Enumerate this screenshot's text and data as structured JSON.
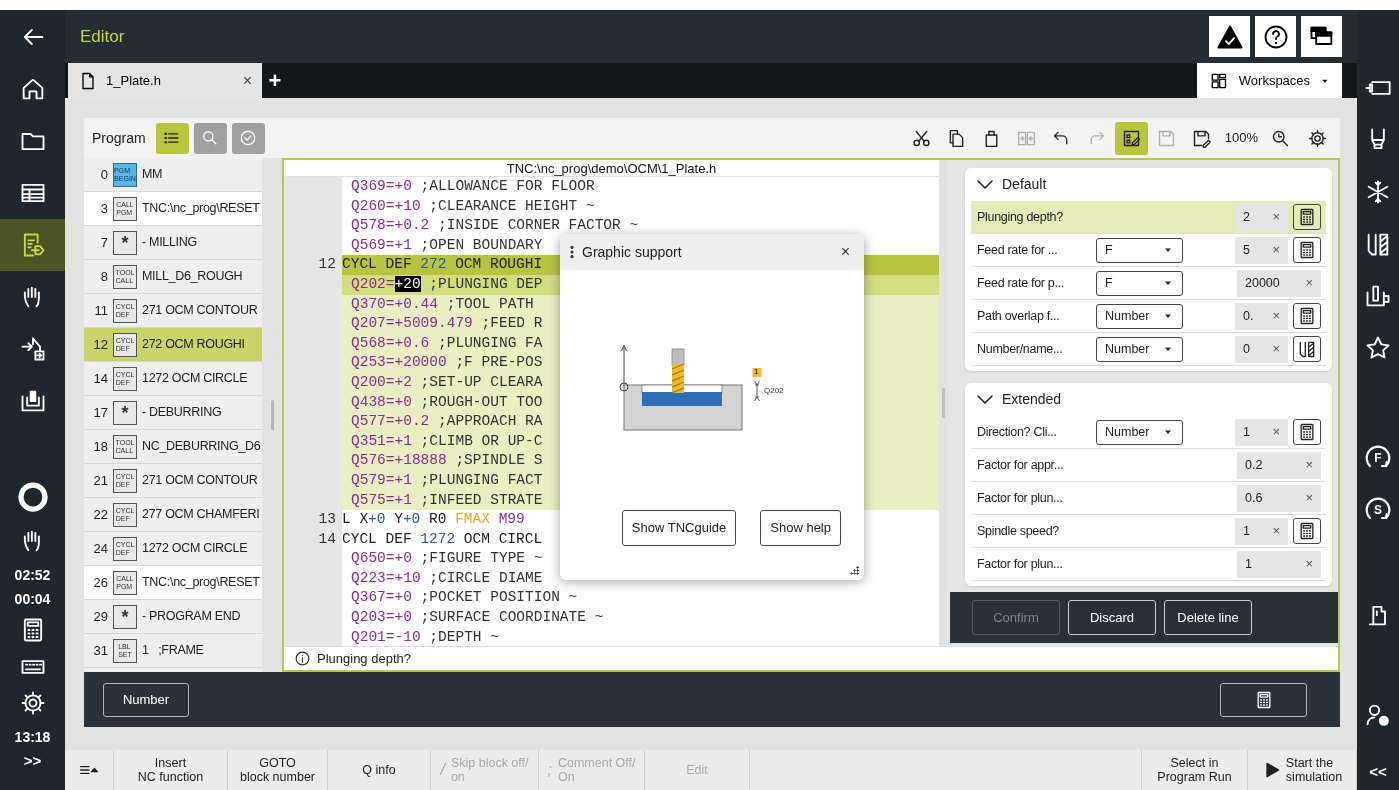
{
  "header": {
    "title": "Editor"
  },
  "left_nav": {
    "items": [
      {
        "selected": false
      },
      {
        "selected": false
      },
      {
        "selected": false
      },
      {
        "selected": true
      },
      {
        "selected": false
      },
      {
        "selected": false
      },
      {
        "selected": false
      }
    ],
    "timers": [
      "02:52",
      "00:04"
    ],
    "clock": "13:18",
    "expand": ">>"
  },
  "right_nav": {
    "override_buttons": [
      "F",
      "S"
    ],
    "collapse": "<<"
  },
  "tabs": [
    {
      "label": "1_Plate.h",
      "close": "×",
      "selected": true
    }
  ],
  "new_tab": "+",
  "workspaces": {
    "label": "Workspaces"
  },
  "toolbar": {
    "title": "Program",
    "views": [
      {
        "selected": true
      },
      {
        "selected": false
      },
      {
        "selected": false
      }
    ],
    "tools": [
      {
        "disabled": false,
        "selected": false
      },
      {
        "disabled": false,
        "selected": false
      },
      {
        "disabled": false,
        "selected": false
      },
      {
        "disabled": true,
        "selected": false
      },
      {
        "disabled": false,
        "selected": false
      },
      {
        "disabled": true,
        "selected": false
      },
      {
        "disabled": false,
        "selected": true
      },
      {
        "disabled": true,
        "selected": false
      },
      {
        "disabled": false,
        "selected": false
      }
    ],
    "zoom_level": "100%"
  },
  "program": {
    "rows": [
      {
        "number": "0",
        "badge": [
          "PGM",
          "BEGIN"
        ],
        "kind": "begin",
        "text": "MM",
        "selected": false
      },
      {
        "number": "3",
        "badge": [
          "CALL",
          "PGM"
        ],
        "kind": "call",
        "text": "TNC:\\nc_prog\\RESET",
        "selected": false
      },
      {
        "number": "7",
        "badge": [
          "*"
        ],
        "kind": "comment",
        "text": "- MILLING",
        "selected": false
      },
      {
        "number": "8",
        "badge": [
          "TOOL",
          "CALL"
        ],
        "kind": "tool",
        "text": "MILL_D6_ROUGH",
        "selected": false
      },
      {
        "number": "11",
        "badge": [
          "CYCL",
          "DEF"
        ],
        "kind": "cycle",
        "text": "271 OCM CONTOUR",
        "selected": false
      },
      {
        "number": "12",
        "badge": [
          "CYCL",
          "DEF"
        ],
        "kind": "cycle",
        "text": "272 OCM ROUGHI",
        "selected": true
      },
      {
        "number": "14",
        "badge": [
          "CYCL",
          "DEF"
        ],
        "kind": "cycle",
        "text": "1272 OCM CIRCLE",
        "selected": false
      },
      {
        "number": "17",
        "badge": [
          "*"
        ],
        "kind": "comment",
        "text": "- DEBURRING",
        "selected": false
      },
      {
        "number": "18",
        "badge": [
          "TOOL",
          "CALL"
        ],
        "kind": "tool",
        "text": "NC_DEBURRING_D6",
        "selected": false
      },
      {
        "number": "21",
        "badge": [
          "CYCL",
          "DEF"
        ],
        "kind": "cycle",
        "text": "271 OCM CONTOUR",
        "selected": false
      },
      {
        "number": "22",
        "badge": [
          "CYCL",
          "DEF"
        ],
        "kind": "cycle",
        "text": "277 OCM CHAMFERI",
        "selected": false
      },
      {
        "number": "24",
        "badge": [
          "CYCL",
          "DEF"
        ],
        "kind": "cycle",
        "text": "1272 OCM CIRCLE",
        "selected": false
      },
      {
        "number": "26",
        "badge": [
          "CALL",
          "PGM"
        ],
        "kind": "call",
        "text": "TNC:\\nc_prog\\RESET",
        "selected": false
      },
      {
        "number": "29",
        "badge": [
          "*"
        ],
        "kind": "comment",
        "text": "- PROGRAM END",
        "selected": false
      },
      {
        "number": "31",
        "badge": [
          "LBL",
          "SET"
        ],
        "kind": "label",
        "text": "1   ;FRAME",
        "selected": false
      }
    ]
  },
  "code": {
    "path": "TNC:\\nc_prog\\demo\\OCM\\1_Plate.h",
    "lines": [
      {
        "kind": "plain",
        "parts": [
          {
            "text": "Q369=+0",
            "kind": "param"
          },
          {
            "text": " ;ALLOWANCE FOR FLOOR",
            "kind": "comment"
          }
        ]
      },
      {
        "kind": "plain",
        "parts": [
          {
            "text": "Q260=+10",
            "kind": "param"
          },
          {
            "text": " ;CLEARANCE HEIGHT ~",
            "kind": "comment"
          }
        ]
      },
      {
        "kind": "plain",
        "parts": [
          {
            "text": "Q578=+0.2",
            "kind": "param"
          },
          {
            "text": " ;INSIDE CORNER FACTOR ~",
            "kind": "comment"
          }
        ]
      },
      {
        "kind": "plain",
        "parts": [
          {
            "text": "Q569=+1",
            "kind": "param"
          },
          {
            "text": " ;OPEN BOUNDARY",
            "kind": "comment"
          }
        ]
      },
      {
        "number": "12",
        "kind": "head",
        "parts": [
          {
            "text": "CYCL DEF ",
            "kind": "keyword"
          },
          {
            "text": "272",
            "kind": "number"
          },
          {
            "text": " OCM ROUGHI",
            "kind": "keyword"
          }
        ]
      },
      {
        "kind": "current",
        "parts": [
          {
            "text": "Q202=",
            "kind": "param"
          },
          {
            "text": "+20",
            "kind": "cursor"
          },
          {
            "text": " ;PLUNGING DEP",
            "kind": "comment"
          }
        ]
      },
      {
        "kind": "block",
        "parts": [
          {
            "text": "Q370=+0.44",
            "kind": "param"
          },
          {
            "text": " ;TOOL PATH",
            "kind": "comment"
          }
        ]
      },
      {
        "kind": "block",
        "parts": [
          {
            "text": "Q207=+5009.479",
            "kind": "param"
          },
          {
            "text": " ;FEED R",
            "kind": "comment"
          }
        ]
      },
      {
        "kind": "block",
        "parts": [
          {
            "text": "Q568=+0.6",
            "kind": "param"
          },
          {
            "text": " ;PLUNGING FA",
            "kind": "comment"
          }
        ]
      },
      {
        "kind": "block",
        "parts": [
          {
            "text": "Q253=+20000",
            "kind": "param"
          },
          {
            "text": " ;F PRE-POS",
            "kind": "comment"
          }
        ]
      },
      {
        "kind": "block",
        "parts": [
          {
            "text": "Q200=+2",
            "kind": "param"
          },
          {
            "text": " ;SET-UP CLEARA",
            "kind": "comment"
          }
        ]
      },
      {
        "kind": "block",
        "parts": [
          {
            "text": "Q438=+0",
            "kind": "param"
          },
          {
            "text": " ;ROUGH-OUT TOO",
            "kind": "comment"
          }
        ]
      },
      {
        "kind": "block",
        "parts": [
          {
            "text": "Q577=+0.2",
            "kind": "param"
          },
          {
            "text": " ;APPROACH RA",
            "kind": "comment"
          }
        ]
      },
      {
        "kind": "block",
        "parts": [
          {
            "text": "Q351=+1",
            "kind": "param"
          },
          {
            "text": " ;CLIMB OR UP-C",
            "kind": "comment"
          }
        ]
      },
      {
        "kind": "block",
        "parts": [
          {
            "text": "Q576=+18888",
            "kind": "param"
          },
          {
            "text": " ;SPINDLE S",
            "kind": "comment"
          }
        ]
      },
      {
        "kind": "block",
        "parts": [
          {
            "text": "Q579=+1",
            "kind": "param"
          },
          {
            "text": " ;PLUNGING FACT",
            "kind": "comment"
          }
        ]
      },
      {
        "kind": "block",
        "parts": [
          {
            "text": "Q575=+1",
            "kind": "param"
          },
          {
            "text": " ;INFEED STRATE",
            "kind": "comment"
          }
        ]
      },
      {
        "number": "13",
        "kind": "plain",
        "parts": [
          {
            "text": "L X",
            "kind": "keyword"
          },
          {
            "text": "+0",
            "kind": "number"
          },
          {
            "text": " Y",
            "kind": "keyword"
          },
          {
            "text": "+0",
            "kind": "number"
          },
          {
            "text": " R0 ",
            "kind": "keyword"
          },
          {
            "text": "FMAX",
            "kind": "rapid"
          },
          {
            "text": " M99",
            "kind": "param"
          }
        ]
      },
      {
        "number": "14",
        "kind": "plain",
        "parts": [
          {
            "text": "CYCL DEF ",
            "kind": "keyword"
          },
          {
            "text": "1272",
            "kind": "number"
          },
          {
            "text": " OCM CIRCL",
            "kind": "keyword"
          }
        ]
      },
      {
        "kind": "plain",
        "parts": [
          {
            "text": "Q650=+0",
            "kind": "param"
          },
          {
            "text": " ;FIGURE TYPE ~",
            "kind": "comment"
          }
        ]
      },
      {
        "kind": "plain",
        "parts": [
          {
            "text": "Q223=+10",
            "kind": "param"
          },
          {
            "text": " ;CIRCLE DIAME",
            "kind": "comment"
          }
        ]
      },
      {
        "kind": "plain",
        "parts": [
          {
            "text": "Q367=+0",
            "kind": "param"
          },
          {
            "text": " ;POCKET POSITION ~",
            "kind": "comment"
          }
        ]
      },
      {
        "kind": "plain",
        "parts": [
          {
            "text": "Q203=+0",
            "kind": "param"
          },
          {
            "text": " ;SURFACE COORDINATE ~",
            "kind": "comment"
          }
        ]
      },
      {
        "kind": "plain",
        "parts": [
          {
            "text": "Q201=-10",
            "kind": "param"
          },
          {
            "text": " ;DEPTH ~",
            "kind": "comment"
          }
        ]
      }
    ]
  },
  "popup": {
    "title": "Graphic support",
    "close": "×",
    "figure_labels": [
      "1",
      "Q202"
    ],
    "buttons": [
      "Show TNCguide",
      "Show help"
    ]
  },
  "form": {
    "groups": [
      {
        "title": "Default",
        "expanded": true,
        "rows": [
          {
            "label": "Plunging depth?",
            "value": "2",
            "clear": "×",
            "kind": "calc",
            "selected": true
          },
          {
            "label": "Feed rate for ...",
            "select": "F",
            "value": "5",
            "clear": "×",
            "kind": "calc",
            "selected": false
          },
          {
            "label": "Feed rate for p...",
            "select": "F",
            "value": "20000",
            "clear": "×",
            "kind": "plain",
            "selected": false
          },
          {
            "label": "Path overlap f...",
            "select": "Number",
            "value": "0.",
            "clear": "×",
            "kind": "calc",
            "selected": false
          },
          {
            "label": "Number/name...",
            "select": "Number",
            "value": "0",
            "clear": "×",
            "kind": "tool",
            "selected": false
          }
        ]
      },
      {
        "title": "Extended",
        "expanded": true,
        "rows": [
          {
            "label": "Direction? Cli...",
            "select": "Number",
            "value": "1",
            "clear": "×",
            "kind": "calc",
            "selected": false
          },
          {
            "label": "Factor for appr...",
            "value": "0.2",
            "clear": "×",
            "kind": "plain",
            "selected": false
          },
          {
            "label": "Factor for plun...",
            "value": "0.6",
            "clear": "×",
            "kind": "plain",
            "selected": false
          },
          {
            "label": "Spindle speed?",
            "value": "1",
            "clear": "×",
            "kind": "calc",
            "selected": false
          },
          {
            "label": "Factor for plun...",
            "value": "1",
            "clear": "×",
            "kind": "plain",
            "selected": false
          }
        ]
      }
    ],
    "actions": [
      {
        "label": "Confirm",
        "disabled": true
      },
      {
        "label": "Discard",
        "disabled": false
      },
      {
        "label": "Delete line",
        "disabled": false
      }
    ]
  },
  "status_line": {
    "text": "Plunging depth?"
  },
  "editor_footer": {
    "number_button": "Number"
  },
  "function_bar": {
    "left": [
      {
        "lines": [
          "Insert",
          "NC function"
        ],
        "disabled": false
      },
      {
        "lines": [
          "GOTO",
          "block number"
        ],
        "disabled": false
      },
      {
        "lines": [
          "Q info"
        ],
        "disabled": false
      },
      {
        "symbol": "/",
        "lines": [
          "Skip block off/",
          "on"
        ],
        "disabled": true
      },
      {
        "symbol": ";",
        "lines": [
          "Comment Off/",
          "On"
        ],
        "disabled": true
      },
      {
        "lines": [
          "Edit"
        ],
        "disabled": true
      }
    ],
    "right": [
      {
        "lines": [
          "Select in",
          "Program Run"
        ],
        "disabled": false
      },
      {
        "play": true,
        "lines": [
          "Start the",
          "simulation"
        ],
        "disabled": false
      }
    ]
  }
}
